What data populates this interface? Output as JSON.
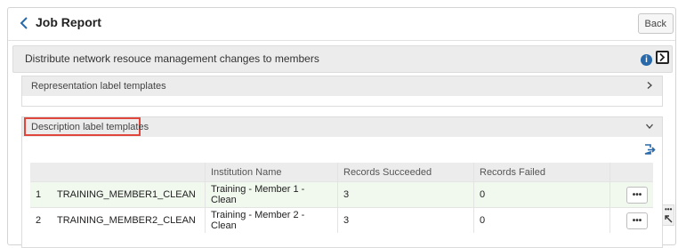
{
  "header": {
    "title": "Job Report",
    "back_label": "Back"
  },
  "job": {
    "title": "Distribute network resouce management changes to members",
    "info_symbol": "i"
  },
  "sections": [
    {
      "label": "Representation label templates",
      "state": "collapsed"
    },
    {
      "label": "Description label templates",
      "state": "expanded"
    }
  ],
  "table": {
    "columns": [
      "",
      "",
      "Institution Name",
      "Records Succeeded",
      "Records Failed",
      ""
    ],
    "rows": [
      {
        "index": "1",
        "code": "TRAINING_MEMBER1_CLEAN",
        "institution": "Training - Member 1 - Clean",
        "succeeded": "3",
        "failed": "0",
        "actions": "•••"
      },
      {
        "index": "2",
        "code": "TRAINING_MEMBER2_CLEAN",
        "institution": "Training - Member 2 - Clean",
        "succeeded": "3",
        "failed": "0",
        "actions": "•••"
      }
    ]
  },
  "side_tools": {
    "dots": "•••"
  },
  "colors": {
    "accent": "#2769aa",
    "highlight_border": "#e0463c",
    "row_tint": "#f1f8ee"
  },
  "icons": [
    "chevron-left-icon",
    "info-icon",
    "expand-panel-icon",
    "chevron-right-icon",
    "chevron-down-icon",
    "export-icon",
    "more-actions-icon",
    "resize-icon"
  ]
}
